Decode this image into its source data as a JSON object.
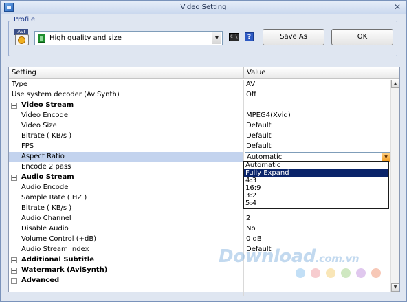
{
  "window": {
    "title": "Video Setting",
    "close_glyph": "✕"
  },
  "profile": {
    "legend": "Profile",
    "format_tag": "AVI",
    "selected_profile": "High quality and size",
    "cmd_icon_text": "C:\\",
    "help_icon_text": "?",
    "save_as_label": "Save As",
    "ok_label": "OK"
  },
  "grid": {
    "headers": {
      "setting": "Setting",
      "value": "Value"
    },
    "rows": [
      {
        "setting": "Type",
        "value": "AVI"
      },
      {
        "setting": "Use system decoder (AviSynth)",
        "value": "Off"
      },
      {
        "setting": "Video Stream",
        "value": "",
        "expander": "−"
      },
      {
        "setting": "Video Encode",
        "value": "MPEG4(Xvid)"
      },
      {
        "setting": "Video Size",
        "value": "Default"
      },
      {
        "setting": "Bitrate ( KB/s )",
        "value": "Default"
      },
      {
        "setting": "FPS",
        "value": "Default"
      },
      {
        "setting": "Aspect Ratio",
        "value": "Automatic"
      },
      {
        "setting": "Encode 2 pass",
        "value": ""
      },
      {
        "setting": "Audio Stream",
        "value": "",
        "expander": "−"
      },
      {
        "setting": "Audio Encode",
        "value": ""
      },
      {
        "setting": "Sample Rate ( HZ )",
        "value": ""
      },
      {
        "setting": "Bitrate ( KB/s )",
        "value": ""
      },
      {
        "setting": "Audio Channel",
        "value": "2"
      },
      {
        "setting": "Disable Audio",
        "value": "No"
      },
      {
        "setting": "Volume Control (+dB)",
        "value": "0 dB"
      },
      {
        "setting": "Audio Stream Index",
        "value": "Default"
      },
      {
        "setting": "Additional Subtitle",
        "value": "",
        "expander": "+"
      },
      {
        "setting": "Watermark (AviSynth)",
        "value": "",
        "expander": "+"
      },
      {
        "setting": "Advanced",
        "value": "",
        "expander": "+"
      }
    ],
    "dropdown_options": [
      "Automatic",
      "Fully Expand",
      "4:3",
      "16:9",
      "3:2",
      "5:4"
    ],
    "dropdown_selected": "Fully Expand"
  },
  "watermark": {
    "text": "Download",
    "suffix": ".com.vn",
    "dot_colors": [
      "#8fc4ee",
      "#f0a3a8",
      "#f4d27b",
      "#a8d58e",
      "#c79ae0",
      "#f19a7c"
    ]
  },
  "colors": {
    "selection": "#0a246a",
    "row_highlight": "#c3d3ee",
    "window_bg": "#dfe6f1"
  }
}
